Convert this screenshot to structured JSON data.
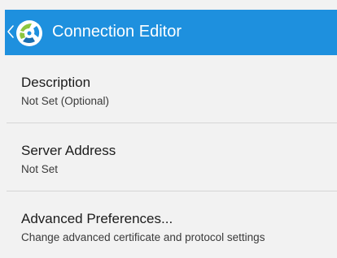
{
  "app_bar": {
    "title": "Connection Editor",
    "back_icon": "chevron-left-icon",
    "app_icon": "app-logo-icon",
    "color": "#1e90de"
  },
  "settings": {
    "items": [
      {
        "title": "Description",
        "subtitle": "Not Set (Optional)"
      },
      {
        "title": "Server Address",
        "subtitle": "Not Set"
      },
      {
        "title": "Advanced Preferences...",
        "subtitle": "Change advanced certificate and protocol settings"
      }
    ]
  }
}
